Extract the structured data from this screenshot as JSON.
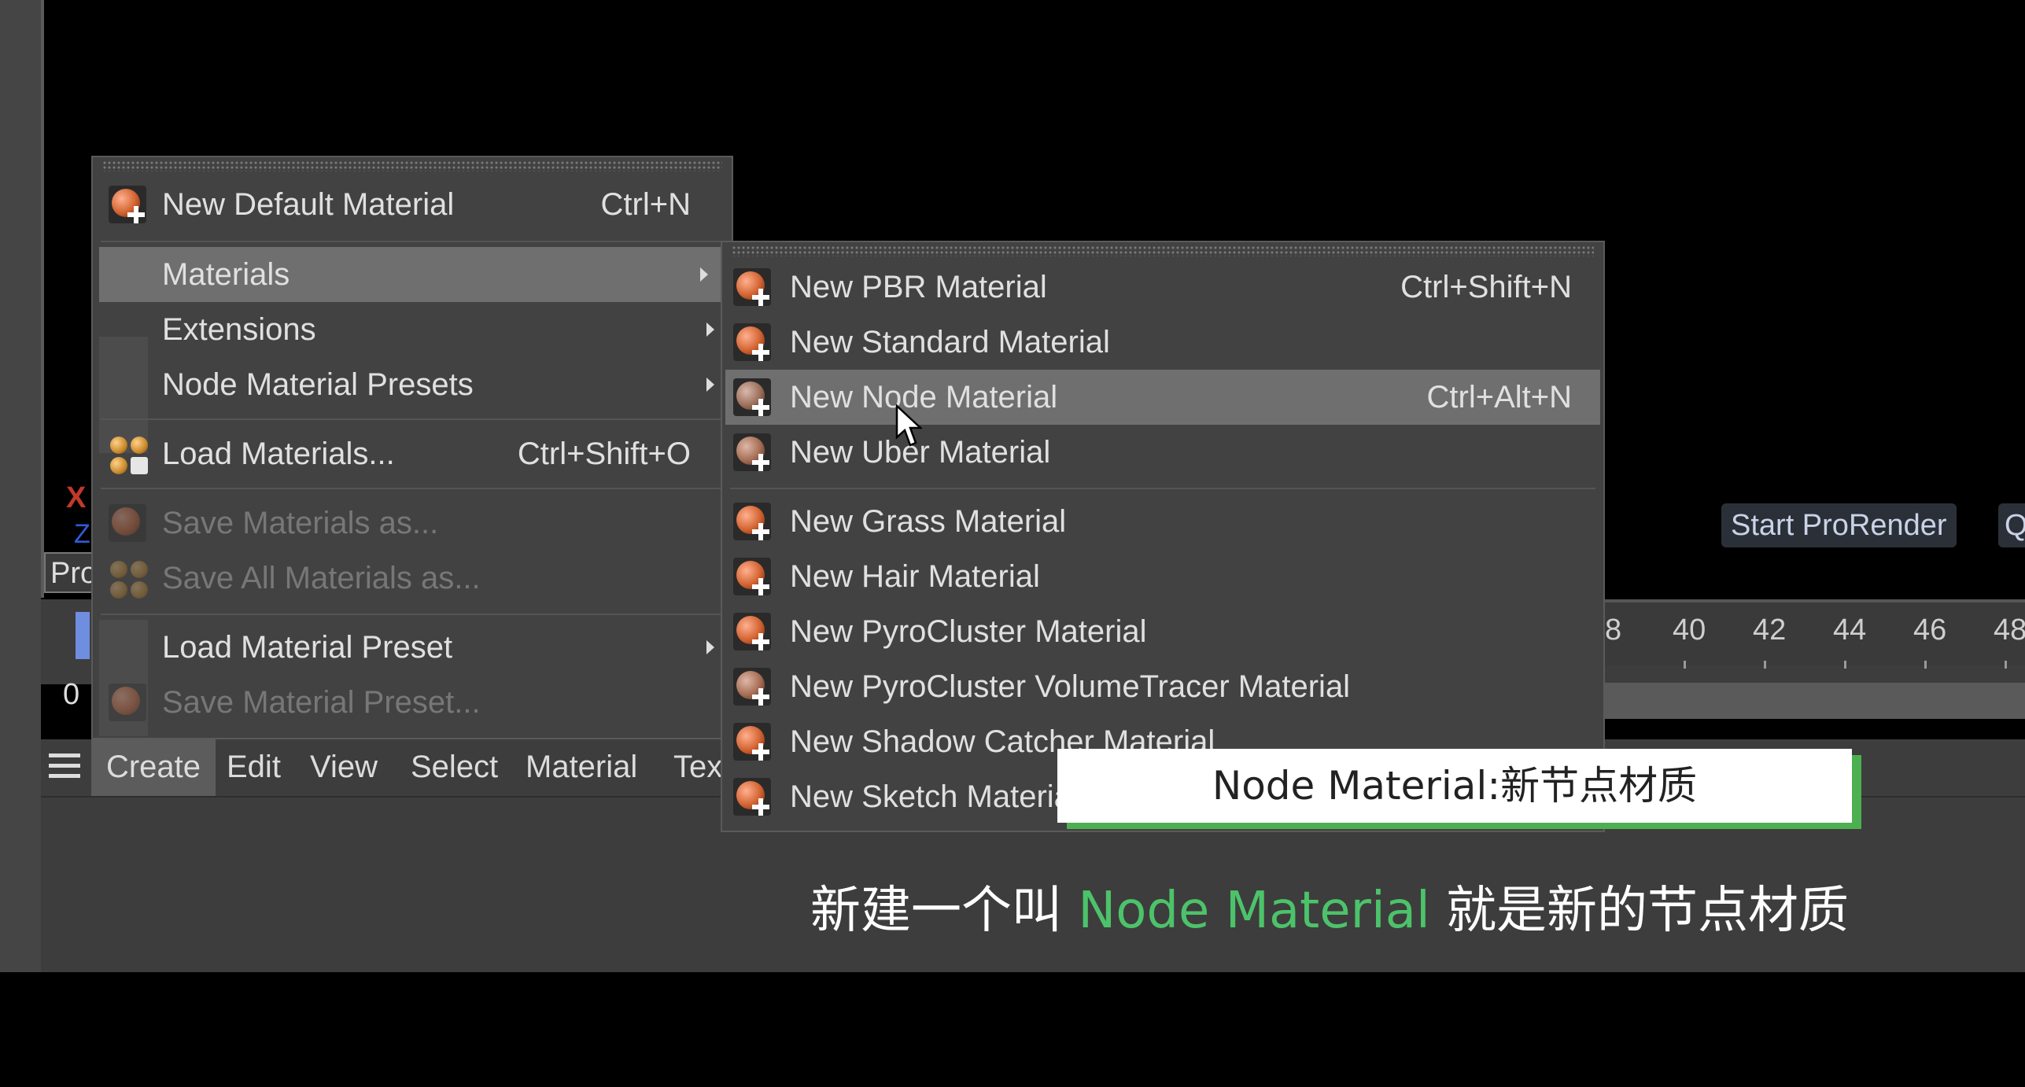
{
  "viewport": {
    "axis_x": "X",
    "axis_z": "Z",
    "pro_label": "Pro",
    "start_prorender": "Start ProRender",
    "q_button": "Q"
  },
  "timeline": {
    "ticks": [
      "8",
      "40",
      "42",
      "44",
      "46",
      "48"
    ],
    "frame": "0"
  },
  "menubar": {
    "items": [
      "Create",
      "Edit",
      "View",
      "Select",
      "Material",
      "Tex"
    ]
  },
  "create_menu": {
    "items": [
      {
        "label": "New Default Material",
        "shortcut": "Ctrl+N",
        "icon": "material-add-icon"
      },
      {
        "label": "Materials",
        "submenu": true
      },
      {
        "label": "Extensions",
        "submenu": true
      },
      {
        "label": "Node Material Presets",
        "submenu": true
      },
      {
        "label": "Load Materials...",
        "shortcut": "Ctrl+Shift+O",
        "icon": "load-materials-icon"
      },
      {
        "label": "Save Materials as...",
        "disabled": true,
        "icon": "save-materials-icon"
      },
      {
        "label": "Save All Materials as...",
        "disabled": true,
        "icon": "save-all-materials-icon"
      },
      {
        "label": "Load Material Preset",
        "submenu": true
      },
      {
        "label": "Save Material Preset...",
        "disabled": true,
        "icon": "save-preset-icon"
      }
    ]
  },
  "materials_submenu": {
    "items": [
      {
        "label": "New PBR Material",
        "shortcut": "Ctrl+Shift+N"
      },
      {
        "label": "New Standard Material",
        "shortcut": ""
      },
      {
        "label": "New Node Material",
        "shortcut": "Ctrl+Alt+N"
      },
      {
        "label": "New Uber Material",
        "shortcut": ""
      },
      {
        "label": "New Grass Material",
        "shortcut": ""
      },
      {
        "label": "New Hair Material",
        "shortcut": ""
      },
      {
        "label": "New PyroCluster Material",
        "shortcut": ""
      },
      {
        "label": "New PyroCluster VolumeTracer Material",
        "shortcut": ""
      },
      {
        "label": "New Shadow Catcher Material",
        "shortcut": ""
      },
      {
        "label": "New Sketch Material",
        "shortcut": ""
      }
    ]
  },
  "caption": {
    "box": "Node Material:新节点材质",
    "subtitle_before": "新建一个叫 ",
    "subtitle_highlight": "Node Material",
    "subtitle_after": "  就是新的节点材质"
  },
  "colors": {
    "highlight": "#6f6f6f",
    "menu_bg": "#424242",
    "caption_green": "#4cc36a"
  }
}
